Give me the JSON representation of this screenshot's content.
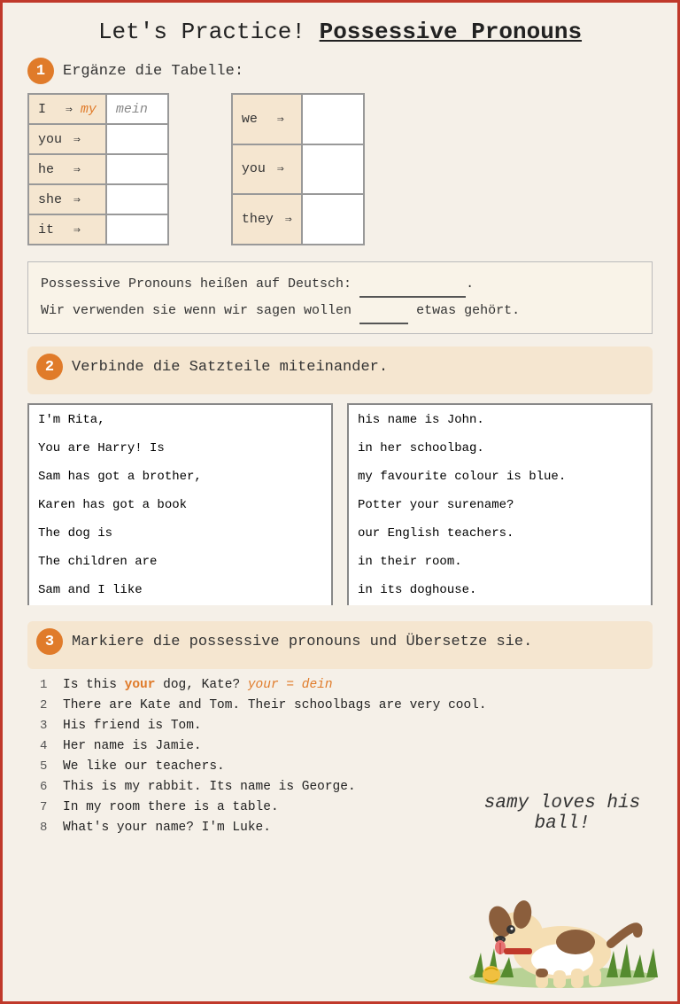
{
  "title": {
    "part1": "Let's Practice! ",
    "part2": "Possessive Pronouns"
  },
  "section1": {
    "label": "1",
    "instruction": "Ergänze die Tabelle:",
    "left_table": [
      {
        "pronoun": "I",
        "arrow": "⇒",
        "filled": "my",
        "german": "mein"
      },
      {
        "pronoun": "you",
        "arrow": "⇒",
        "filled": "",
        "german": ""
      },
      {
        "pronoun": "he",
        "arrow": "⇒",
        "filled": "",
        "german": ""
      },
      {
        "pronoun": "she",
        "arrow": "⇒",
        "filled": "",
        "german": ""
      },
      {
        "pronoun": "it",
        "arrow": "⇒",
        "filled": "",
        "german": ""
      }
    ],
    "right_table": [
      {
        "pronoun": "we",
        "arrow": "⇒",
        "filled": ""
      },
      {
        "pronoun": "you",
        "arrow": "⇒",
        "filled": ""
      },
      {
        "pronoun": "they",
        "arrow": "⇒",
        "filled": ""
      }
    ]
  },
  "poss_box": {
    "line1_before": "Possessive Pronouns heißen auf Deutsch: ",
    "line1_blank": "",
    "line2_before": "Wir verwenden sie wenn wir sagen wollen ",
    "line2_blank": "",
    "line2_after": " etwas gehört."
  },
  "section2": {
    "label": "2",
    "instruction": "Verbinde die Satzteile miteinander.",
    "left_items": [
      "I'm Rita,",
      "You are Harry! Is",
      "Sam has got a brother,",
      "Karen has got a book",
      "The dog is",
      "The children are",
      "Sam and I like"
    ],
    "right_items": [
      "his name is John.",
      "in her schoolbag.",
      "my favourite colour is blue.",
      "Potter your surename?",
      "our English teachers.",
      "in their room.",
      "in its doghouse."
    ]
  },
  "section3": {
    "label": "3",
    "instruction": "Markiere die possessive pronouns und Übersetze sie.",
    "items": [
      {
        "num": "1",
        "text_before": "Is this ",
        "highlight": "your",
        "text_after": " dog, Kate? ",
        "answer": "your = dein"
      },
      {
        "num": "2",
        "text": "There are Kate and Tom. Their schoolbags are very cool."
      },
      {
        "num": "3",
        "text": "His friend is Tom."
      },
      {
        "num": "4",
        "text": "Her name is Jamie."
      },
      {
        "num": "5",
        "text": "We like our teachers."
      },
      {
        "num": "6",
        "text": "This is my rabbit. Its name is George."
      },
      {
        "num": "7",
        "text": "In my room there is a table."
      },
      {
        "num": "8",
        "text": "What's your name? I'm Luke."
      }
    ]
  },
  "dog_caption": "samy loves his ball!",
  "icons": {
    "arrow_right": "⇒"
  }
}
